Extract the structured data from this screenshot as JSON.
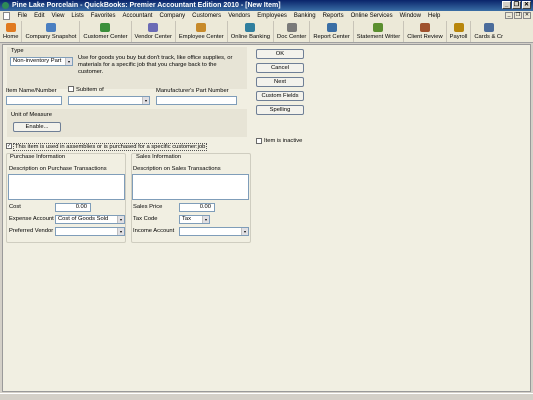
{
  "window": {
    "title": "Pine Lake Porcelain  - QuickBooks: Premier Accountant Edition 2010 - [New Item]",
    "minimize": "_",
    "restore": "❐",
    "close": "✕"
  },
  "menu": [
    "File",
    "Edit",
    "View",
    "Lists",
    "Favorites",
    "Accountant",
    "Company",
    "Customers",
    "Vendors",
    "Employees",
    "Banking",
    "Reports",
    "Online Services",
    "Window",
    "Help"
  ],
  "toolbar": [
    {
      "label": "Home",
      "icon": "home-icon",
      "color": "#e07a20"
    },
    {
      "label": "Company Snapshot",
      "icon": "snapshot-icon",
      "color": "#4a7fc1"
    },
    {
      "label": "Customer Center",
      "icon": "customer-icon",
      "color": "#3b8f3b"
    },
    {
      "label": "Vendor Center",
      "icon": "vendor-icon",
      "color": "#6b6bb5"
    },
    {
      "label": "Employee Center",
      "icon": "employee-icon",
      "color": "#c78a2a"
    },
    {
      "label": "Online Banking",
      "icon": "bank-icon",
      "color": "#2f7f9f"
    },
    {
      "label": "Doc Center",
      "icon": "doc-icon",
      "color": "#7a7a7a"
    },
    {
      "label": "Report Center",
      "icon": "report-icon",
      "color": "#3a6ea5"
    },
    {
      "label": "Statement Writer",
      "icon": "statement-icon",
      "color": "#5b8f2f"
    },
    {
      "label": "Client Review",
      "icon": "review-icon",
      "color": "#a0522d"
    },
    {
      "label": "Payroll",
      "icon": "payroll-icon",
      "color": "#b8860b"
    },
    {
      "label": "Cards & Cr",
      "icon": "cards-icon",
      "color": "#4b6c9b"
    }
  ],
  "form": {
    "type_label": "Type",
    "type_value": "Non-inventory Part",
    "type_desc": "Use for goods you buy but don't track, like office supplies, or materials for a specific job that you charge back to the customer.",
    "item_name_label": "Item Name/Number",
    "item_name_value": "",
    "subitem_label": "Subitem of",
    "subitem_value": "",
    "mfr_label": "Manufacturer's Part Number",
    "mfr_value": "",
    "uom_label": "Unit of Measure",
    "enable_button": "Enable...",
    "assemblies_label": "This item is used in assemblies or is purchased for a specific customer:job",
    "purchase_header": "Purchase Information",
    "sales_header": "Sales Information",
    "purchase_desc_label": "Description on Purchase Transactions",
    "sales_desc_label": "Description on Sales Transactions",
    "cost_label": "Cost",
    "cost_value": "0.00",
    "expense_label": "Expense Account",
    "expense_value": "Cost of Goods Sold",
    "vendor_label": "Preferred Vendor",
    "vendor_value": "",
    "sales_price_label": "Sales Price",
    "sales_price_value": "0.00",
    "tax_label": "Tax Code",
    "tax_value": "Tax",
    "income_label": "Income Account",
    "income_value": "",
    "inactive_label": "Item is inactive"
  },
  "buttons": {
    "ok": "OK",
    "cancel": "Cancel",
    "next": "Next",
    "custom_fields": "Custom Fields",
    "spelling": "Spelling"
  },
  "icons": {
    "dropdown": "▾",
    "check": "✓"
  }
}
